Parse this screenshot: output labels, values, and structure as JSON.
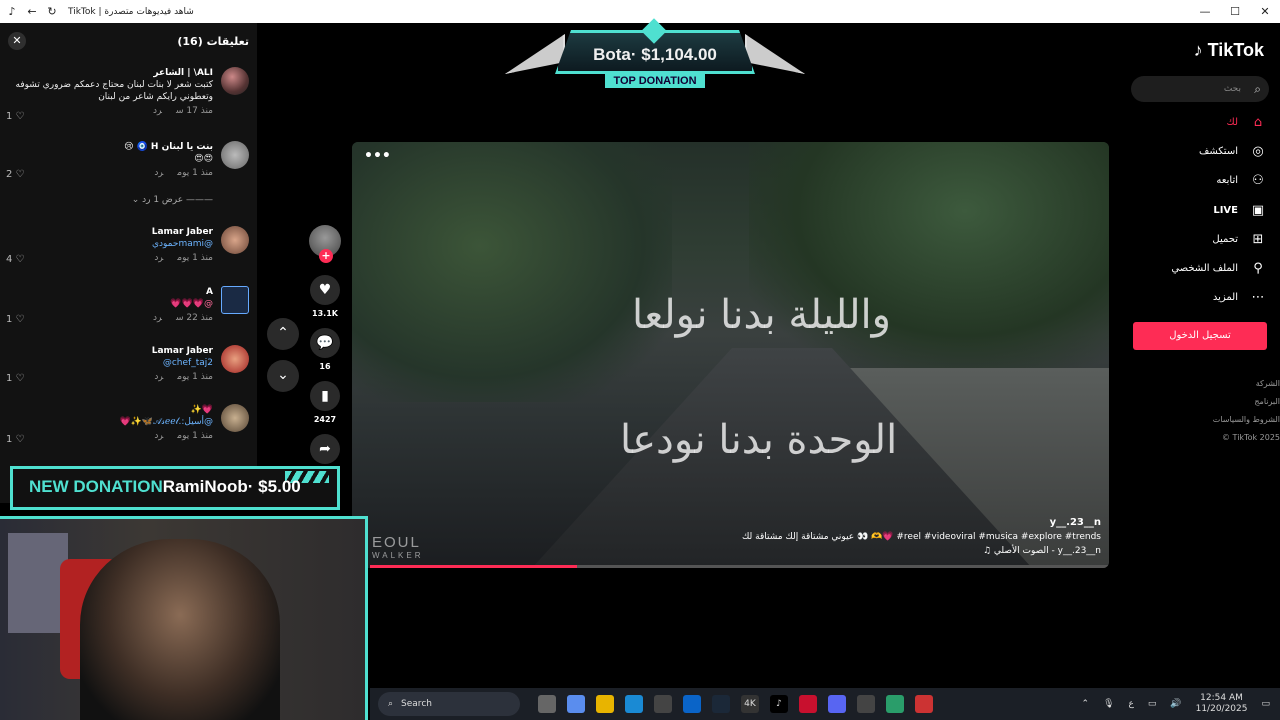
{
  "window": {
    "title": "TikTok | شاهد فيديوهات متصدرة",
    "controls": {
      "minimize": "—",
      "maximize": "☐",
      "close": "✕"
    }
  },
  "comments_panel": {
    "title": "تعليقات (16)",
    "close": "✕",
    "items": [
      {
        "user": "ALI\\ | الشاعر",
        "text": "كتبت شعر لا بنات لبنان محتاج دعمكم ضروري تشوفه وتعطوني رايكم شاعر من لبنان",
        "time": "منذ 17 س",
        "reply": "رد",
        "likes": "1"
      },
      {
        "user": "بنت يا لبنان H 🧿 😢",
        "text": "😍😍",
        "time": "منذ 1 يوم",
        "reply": "رد",
        "likes": "2"
      },
      {
        "user": "Lamar Jaber",
        "text": "@mamiحمودي",
        "time": "منذ 1 يوم",
        "reply": "رد",
        "likes": "4"
      },
      {
        "user": "A",
        "text": "@💗💗💗",
        "time": "منذ 22 س",
        "reply": "رد",
        "likes": "1"
      },
      {
        "user": "Lamar Jaber",
        "text": "@chef_taj2",
        "time": "منذ 1 يوم",
        "reply": "رد",
        "likes": "1"
      },
      {
        "user": "💗✨",
        "text": "@أسيل:.𝒜𝓈ℯℯ𝓁🦋✨💗",
        "time": "منذ 1 يوم",
        "reply": "رد",
        "likes": "1"
      }
    ],
    "view_replies": "عرض 1 رد"
  },
  "action_rail": {
    "likes": "13.1K",
    "comments": "16",
    "saves": "2427"
  },
  "donation_top": {
    "amount": "Bota· $1,104.00",
    "label": "TOP DONATION"
  },
  "donation_new": {
    "label": "NEW DONATION",
    "text": "RamiNoob· $5.00"
  },
  "video": {
    "overlay_line1": "والليلة بدنا نولعا",
    "overlay_line2": "الوحدة بدنا نودعا",
    "watermark": "EOUL",
    "watermark_sub": "WALKER",
    "author": "y__.23__n",
    "caption": "عيوني مشتاقة إلك مشتاقة لك 👀 🫶💗 #reel #videoviral #musica #explore #trends",
    "sound": "♫ الصوت الأصلي - y__.23__n",
    "more": "•••",
    "progress": 0.28
  },
  "sidebar": {
    "logo": "TikTok",
    "search_placeholder": "بحث",
    "nav": [
      {
        "label": "لك",
        "icon": "home-icon",
        "glyph": "⌂"
      },
      {
        "label": "استكشف",
        "icon": "compass-icon",
        "glyph": "◎"
      },
      {
        "label": "اتابعه",
        "icon": "user-follow-icon",
        "glyph": "⚇"
      },
      {
        "label": "LIVE",
        "icon": "live-icon",
        "glyph": "▣"
      },
      {
        "label": "تحميل",
        "icon": "upload-icon",
        "glyph": "⊞"
      },
      {
        "label": "الملف الشخصي",
        "icon": "profile-icon",
        "glyph": "⚲"
      },
      {
        "label": "المزيد",
        "icon": "more-icon",
        "glyph": "⋯"
      }
    ],
    "login": "تسجيل الدخول",
    "footer": [
      "الشركة",
      "البرنامج",
      "الشروط والسياسات",
      "TikTok 2025 ©"
    ]
  },
  "taskbar": {
    "search": "Search",
    "time": "12:54 AM",
    "date": "11/20/2025",
    "lang": "ع"
  },
  "colors": {
    "accent": "#fe2c55",
    "donation_teal": "#4fe0d0"
  }
}
